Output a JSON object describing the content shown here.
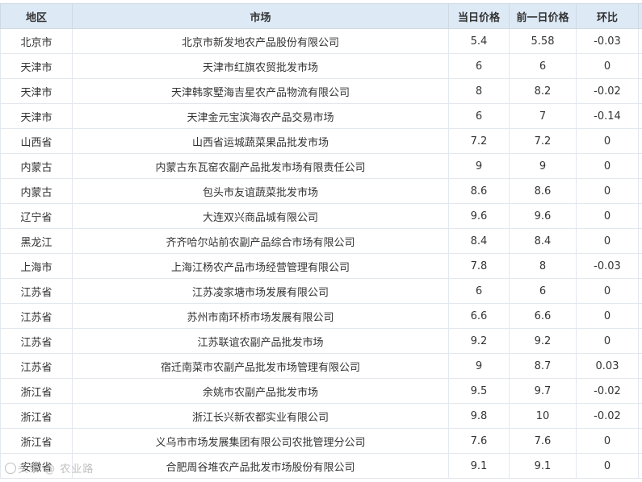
{
  "table": {
    "headers": {
      "region": "地区",
      "market": "市场",
      "today_price": "当日价格",
      "prev_price": "前一日价格",
      "change": "环比"
    },
    "rows": [
      {
        "region": "北京市",
        "market": "北京市新发地农产品股份有限公司",
        "today": "5.4",
        "prev": "5.58",
        "change": "-0.03"
      },
      {
        "region": "天津市",
        "market": "天津市红旗农贸批发市场",
        "today": "6",
        "prev": "6",
        "change": "0"
      },
      {
        "region": "天津市",
        "market": "天津韩家墅海吉星农产品物流有限公司",
        "today": "8",
        "prev": "8.2",
        "change": "-0.02"
      },
      {
        "region": "天津市",
        "market": "天津金元宝滨海农产品交易市场",
        "today": "6",
        "prev": "7",
        "change": "-0.14"
      },
      {
        "region": "山西省",
        "market": "山西省运城蔬菜果品批发市场",
        "today": "7.2",
        "prev": "7.2",
        "change": "0"
      },
      {
        "region": "内蒙古",
        "market": "内蒙古东瓦窑农副产品批发市场有限责任公司",
        "today": "9",
        "prev": "9",
        "change": "0"
      },
      {
        "region": "内蒙古",
        "market": "包头市友谊蔬菜批发市场",
        "today": "8.6",
        "prev": "8.6",
        "change": "0"
      },
      {
        "region": "辽宁省",
        "market": "大连双兴商品城有限公司",
        "today": "9.6",
        "prev": "9.6",
        "change": "0"
      },
      {
        "region": "黑龙江",
        "market": "齐齐哈尔站前农副产品综合市场有限公司",
        "today": "8.4",
        "prev": "8.4",
        "change": "0"
      },
      {
        "region": "上海市",
        "market": "上海江杨农产品市场经营管理有限公司",
        "today": "7.8",
        "prev": "8",
        "change": "-0.03"
      },
      {
        "region": "江苏省",
        "market": "江苏凌家塘市场发展有限公司",
        "today": "6",
        "prev": "6",
        "change": "0"
      },
      {
        "region": "江苏省",
        "market": "苏州市南环桥市场发展有限公司",
        "today": "6.6",
        "prev": "6.6",
        "change": "0"
      },
      {
        "region": "江苏省",
        "market": "江苏联谊农副产品批发市场",
        "today": "9.2",
        "prev": "9.2",
        "change": "0"
      },
      {
        "region": "江苏省",
        "market": "宿迁南菜市农副产品批发市场管理有限公司",
        "today": "9",
        "prev": "8.7",
        "change": "0.03"
      },
      {
        "region": "浙江省",
        "market": "余姚市农副产品批发市场",
        "today": "9.5",
        "prev": "9.7",
        "change": "-0.02"
      },
      {
        "region": "浙江省",
        "market": "浙江长兴新农都实业有限公司",
        "today": "9.8",
        "prev": "10",
        "change": "-0.02"
      },
      {
        "region": "浙江省",
        "market": "义乌市市场发展集团有限公司农批管理分公司",
        "today": "7.6",
        "prev": "7.6",
        "change": "0"
      },
      {
        "region": "安徽省",
        "market": "合肥周谷堆农产品批发市场股份有限公司",
        "today": "9.1",
        "prev": "9.1",
        "change": "0"
      }
    ]
  },
  "watermark": {
    "text": "头条 @ 农业路  ",
    "icon": "camera-watermark-icon"
  },
  "colors": {
    "header_bg": "#dde9f5",
    "border": "#e3e8ee",
    "text": "#333333"
  }
}
